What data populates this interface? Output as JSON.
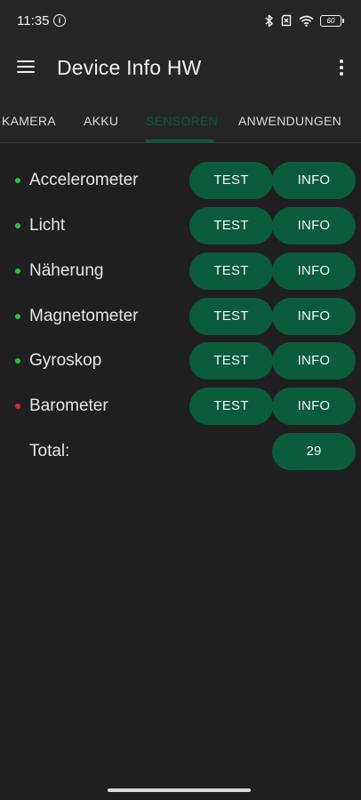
{
  "status": {
    "time": "11:35",
    "info_icon": "i",
    "battery": "60"
  },
  "appbar": {
    "title": "Device Info HW"
  },
  "tabs": [
    {
      "label": "KAMERA"
    },
    {
      "label": "AKKU"
    },
    {
      "label": "SENSOREN"
    },
    {
      "label": "ANWENDUNGEN"
    }
  ],
  "active_tab": "SENSOREN",
  "colors": {
    "accent": "#0b5b3d",
    "dot_green": "#2bbf3a",
    "dot_red": "#d9281f"
  },
  "sensors": [
    {
      "name": "Accelerometer",
      "status": "green",
      "test": "TEST",
      "info": "INFO"
    },
    {
      "name": "Licht",
      "status": "green",
      "test": "TEST",
      "info": "INFO"
    },
    {
      "name": "Näherung",
      "status": "green",
      "test": "TEST",
      "info": "INFO"
    },
    {
      "name": "Magnetometer",
      "status": "green",
      "test": "TEST",
      "info": "INFO"
    },
    {
      "name": "Gyroskop",
      "status": "green",
      "test": "TEST",
      "info": "INFO"
    },
    {
      "name": "Barometer",
      "status": "red",
      "test": "TEST",
      "info": "INFO"
    }
  ],
  "total": {
    "label": "Total:",
    "value": "29"
  }
}
